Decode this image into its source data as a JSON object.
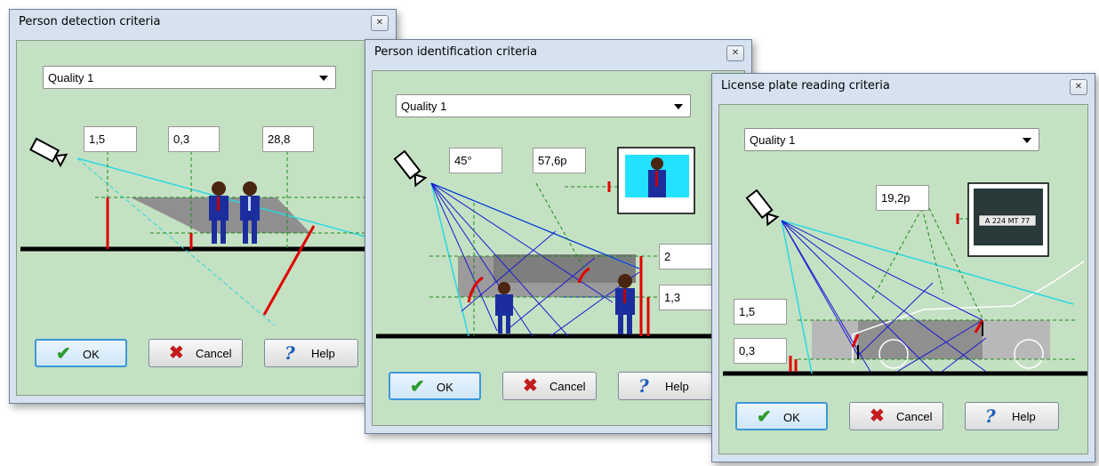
{
  "dialogs": {
    "detection": {
      "title": "Person detection criteria",
      "quality": "Quality 1",
      "values": [
        "1,5",
        "0,3",
        "28,8"
      ]
    },
    "identification": {
      "title": "Person identification criteria",
      "quality": "Quality 1",
      "values": [
        "45°",
        "57,6p",
        "2",
        "1,3"
      ]
    },
    "plate": {
      "title": "License plate reading criteria",
      "quality": "Quality 1",
      "values": [
        "19,2p",
        "1,5",
        "0,3"
      ],
      "plate_text": "A 224 MT 77"
    }
  },
  "buttons": {
    "ok": "OK",
    "cancel": "Cancel",
    "help": "Help"
  },
  "icons": {
    "close": "close-icon",
    "ok": "checkmark-icon",
    "cancel": "x-icon",
    "help": "question-icon",
    "dropdown": "chevron-down-icon"
  },
  "colors": {
    "client_bg": "#c5e1c3",
    "ray_cyan": "#2ad8e0",
    "ray_blue": "#1a1ad0",
    "marker_red": "#e00000",
    "guide_green": "#1a8a1a"
  }
}
